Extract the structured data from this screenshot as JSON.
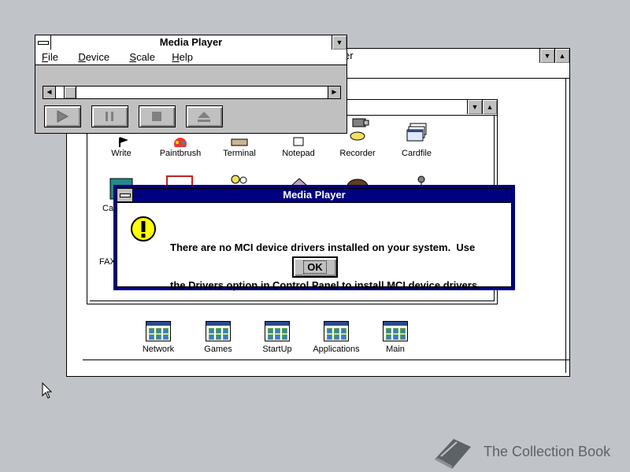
{
  "program_manager": {
    "title_fragment": "er"
  },
  "accessories_icons": [
    {
      "label": "Write"
    },
    {
      "label": "Paintbrush"
    },
    {
      "label": "Terminal"
    },
    {
      "label": "Notepad"
    },
    {
      "label": "Recorder"
    },
    {
      "label": "Cardfile"
    }
  ],
  "partial_labels": {
    "row2_first": "Ca",
    "row3_first": "FAX"
  },
  "groups": [
    {
      "label": "Network"
    },
    {
      "label": "Games"
    },
    {
      "label": "StartUp"
    },
    {
      "label": "Applications"
    },
    {
      "label": "Main"
    }
  ],
  "media_player": {
    "title": "Media Player",
    "menu": [
      {
        "label": "File",
        "hotkey": "F",
        "rest": "ile"
      },
      {
        "label": "Device",
        "hotkey": "D",
        "rest": "evice"
      },
      {
        "label": "Scale",
        "hotkey": "S",
        "rest": "cale"
      },
      {
        "label": "Help",
        "hotkey": "H",
        "rest": "elp"
      }
    ],
    "position": 0.03
  },
  "dialog": {
    "title": "Media Player",
    "message_line1": "There are no MCI device drivers installed on your system.  Use",
    "message_line2": "the Drivers option in Control Panel to install MCI device drivers.",
    "ok_label": "OK"
  },
  "watermark": {
    "text": "The Collection Book"
  },
  "colors": {
    "desktop": "#c0c4c8",
    "active_title": "#000080",
    "warning_yellow": "#ffff00"
  }
}
